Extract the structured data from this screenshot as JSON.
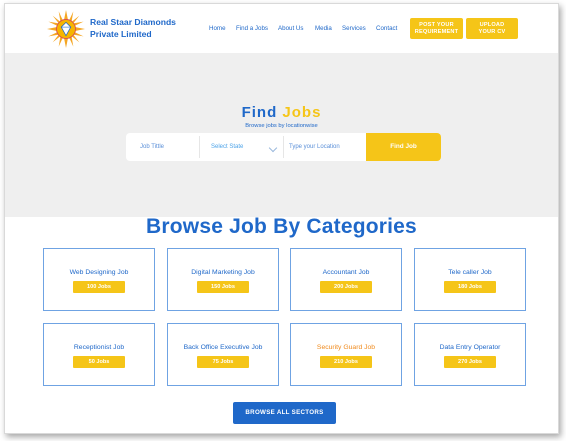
{
  "header": {
    "brand_line1": "Real Staar Diamonds",
    "brand_line2": "Private Limited",
    "logo": "sun-logo",
    "nav": [
      "Home",
      "Find a Jobs",
      "About Us",
      "Media",
      "Services",
      "Contact"
    ],
    "post_button": [
      "POST YOUR",
      "REQUIREMENT"
    ],
    "upload_button": [
      "UPLOAD",
      "YOUR CV"
    ]
  },
  "hero": {
    "title_part1": "Find",
    "title_part2": "Jobs",
    "subtitle": "Browse jobs by locationwise",
    "search": {
      "job_title_placeholder": "Job Tittle",
      "state_select": "Select State",
      "location_placeholder": "Type your Location",
      "find_button": "Find Job"
    }
  },
  "categories": {
    "title": "Browse Job By Categories",
    "items": [
      {
        "name": "Web Designing Job",
        "count": "100 Jobs"
      },
      {
        "name": "Digital Marketing Job",
        "count": "150 Jobs"
      },
      {
        "name": "Accountant Job",
        "count": "200 Jobs"
      },
      {
        "name": "Tele caller Job",
        "count": "180 Jobs"
      },
      {
        "name": "Receptionist Job",
        "count": "50 Jobs"
      },
      {
        "name": "Back Office Executive Job",
        "count": "75 Jobs"
      },
      {
        "name": "Security Guard Job",
        "count": "210 Jobs"
      },
      {
        "name": "Data Entry Operator",
        "count": "270 Jobs"
      }
    ],
    "browse_all": "BROWSE ALL SECTORS"
  },
  "colors": {
    "primary_blue": "#1f68c9",
    "accent_yellow": "#f5c518",
    "hover_orange": "#f08a1c",
    "hero_bg": "#efefef"
  }
}
